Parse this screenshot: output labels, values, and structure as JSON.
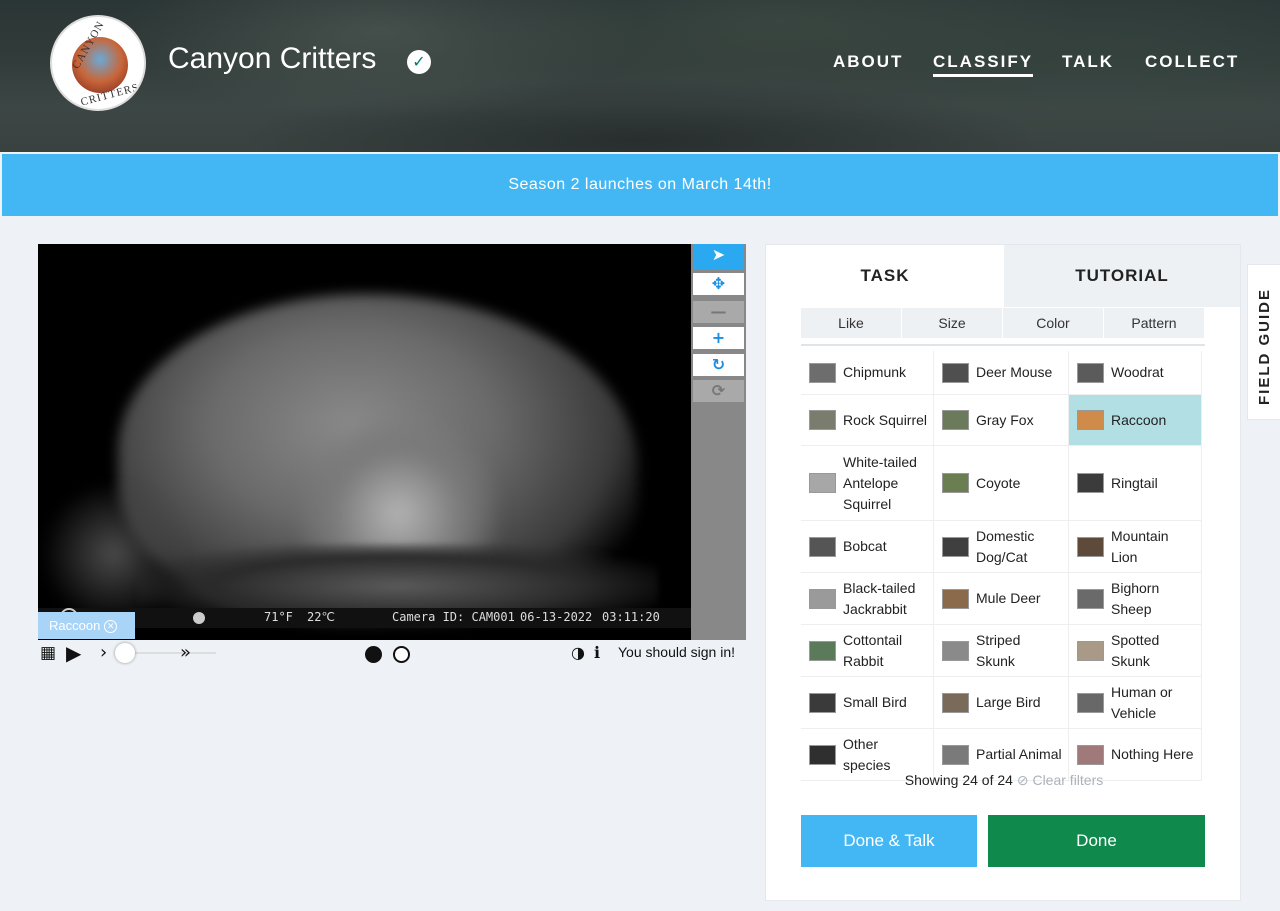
{
  "header": {
    "title": "Canyon Critters",
    "logo_text_top": "CANYON",
    "logo_text_bottom": "CRITTERS",
    "nav": [
      {
        "label": "ABOUT"
      },
      {
        "label": "CLASSIFY",
        "active": true
      },
      {
        "label": "TALK"
      },
      {
        "label": "COLLECT"
      }
    ]
  },
  "banner": {
    "text": "Season 2 launches on March 14th!"
  },
  "viewer": {
    "overlay": {
      "temp_f": "71°F",
      "temp_c": "22℃",
      "camera": "Camera ID: CAM001",
      "date": "06-13-2022",
      "time": "03:11:20"
    },
    "tools": [
      "pointer-icon",
      "move-icon",
      "zoom-out-icon",
      "zoom-in-icon",
      "rotate-icon",
      "reset-icon"
    ],
    "annotation_tag": "Raccoon",
    "signin_text": "You should sign in!",
    "frame_progress": 0.0
  },
  "task": {
    "tabs": [
      "TASK",
      "TUTORIAL"
    ],
    "filters": [
      "Like",
      "Size",
      "Color",
      "Pattern"
    ],
    "choices": [
      {
        "label": "Chipmunk"
      },
      {
        "label": "Deer Mouse"
      },
      {
        "label": "Woodrat"
      },
      {
        "label": "Rock Squirrel"
      },
      {
        "label": "Gray Fox"
      },
      {
        "label": "Raccoon",
        "selected": true
      },
      {
        "label": "White-tailed Antelope Squirrel"
      },
      {
        "label": "Coyote"
      },
      {
        "label": "Ringtail"
      },
      {
        "label": "Bobcat"
      },
      {
        "label": "Domestic Dog/Cat"
      },
      {
        "label": "Mountain Lion"
      },
      {
        "label": "Black-tailed Jackrabbit"
      },
      {
        "label": "Mule Deer"
      },
      {
        "label": "Bighorn Sheep"
      },
      {
        "label": "Cottontail Rabbit"
      },
      {
        "label": "Striped Skunk"
      },
      {
        "label": "Spotted Skunk"
      },
      {
        "label": "Small Bird"
      },
      {
        "label": "Large Bird"
      },
      {
        "label": "Human or Vehicle"
      },
      {
        "label": "Other species"
      },
      {
        "label": "Partial Animal"
      },
      {
        "label": "Nothing Here"
      }
    ],
    "showing": "Showing 24 of 24",
    "clear_filters": "Clear filters",
    "done_talk": "Done & Talk",
    "done": "Done"
  },
  "field_guide": "FIELD GUIDE",
  "colors": {
    "accent": "#43b7f3",
    "done": "#0f8a4c",
    "selected": "#b2dfe4"
  }
}
